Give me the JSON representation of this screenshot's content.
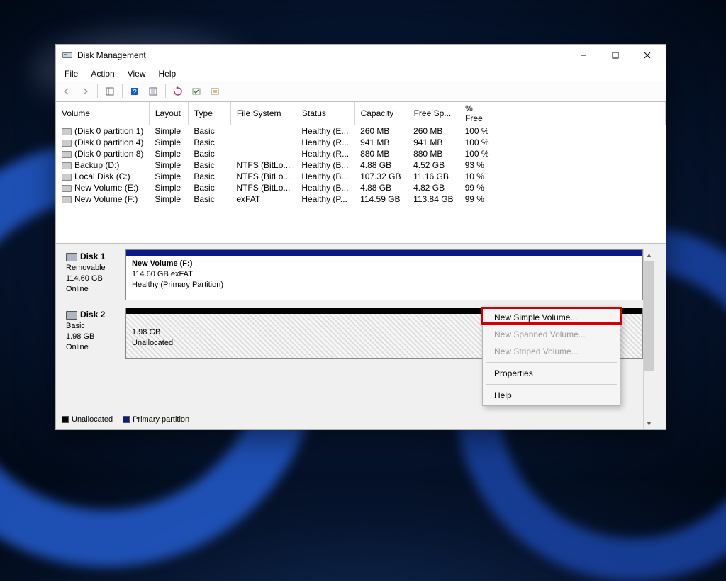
{
  "window": {
    "title": "Disk Management"
  },
  "menubar": [
    "File",
    "Action",
    "View",
    "Help"
  ],
  "columns": [
    "Volume",
    "Layout",
    "Type",
    "File System",
    "Status",
    "Capacity",
    "Free Sp...",
    "% Free"
  ],
  "volumes": [
    {
      "name": "(Disk 0 partition 1)",
      "layout": "Simple",
      "type": "Basic",
      "fs": "",
      "status": "Healthy (E...",
      "capacity": "260 MB",
      "free": "260 MB",
      "pct": "100 %"
    },
    {
      "name": "(Disk 0 partition 4)",
      "layout": "Simple",
      "type": "Basic",
      "fs": "",
      "status": "Healthy (R...",
      "capacity": "941 MB",
      "free": "941 MB",
      "pct": "100 %"
    },
    {
      "name": "(Disk 0 partition 8)",
      "layout": "Simple",
      "type": "Basic",
      "fs": "",
      "status": "Healthy (R...",
      "capacity": "880 MB",
      "free": "880 MB",
      "pct": "100 %"
    },
    {
      "name": "Backup (D:)",
      "layout": "Simple",
      "type": "Basic",
      "fs": "NTFS (BitLo...",
      "status": "Healthy (B...",
      "capacity": "4.88 GB",
      "free": "4.52 GB",
      "pct": "93 %"
    },
    {
      "name": "Local Disk (C:)",
      "layout": "Simple",
      "type": "Basic",
      "fs": "NTFS (BitLo...",
      "status": "Healthy (B...",
      "capacity": "107.32 GB",
      "free": "11.16 GB",
      "pct": "10 %"
    },
    {
      "name": "New Volume (E:)",
      "layout": "Simple",
      "type": "Basic",
      "fs": "NTFS (BitLo...",
      "status": "Healthy (B...",
      "capacity": "4.88 GB",
      "free": "4.82 GB",
      "pct": "99 %"
    },
    {
      "name": "New Volume (F:)",
      "layout": "Simple",
      "type": "Basic",
      "fs": "exFAT",
      "status": "Healthy (P...",
      "capacity": "114.59 GB",
      "free": "113.84 GB",
      "pct": "99 %"
    }
  ],
  "disks": {
    "disk1": {
      "title": "Disk 1",
      "kind": "Removable",
      "size": "114.60 GB",
      "state": "Online",
      "part_title": "New Volume  (F:)",
      "part_sub": "114.60 GB exFAT",
      "part_status": "Healthy (Primary Partition)"
    },
    "disk2": {
      "title": "Disk 2",
      "kind": "Basic",
      "size": "1.98 GB",
      "state": "Online",
      "part_sub": "1.98 GB",
      "part_status": "Unallocated"
    }
  },
  "legend": {
    "unallocated": "Unallocated",
    "primary": "Primary partition"
  },
  "context_menu": {
    "new_simple": "New Simple Volume...",
    "new_spanned": "New Spanned Volume...",
    "new_striped": "New Striped Volume...",
    "properties": "Properties",
    "help": "Help"
  }
}
